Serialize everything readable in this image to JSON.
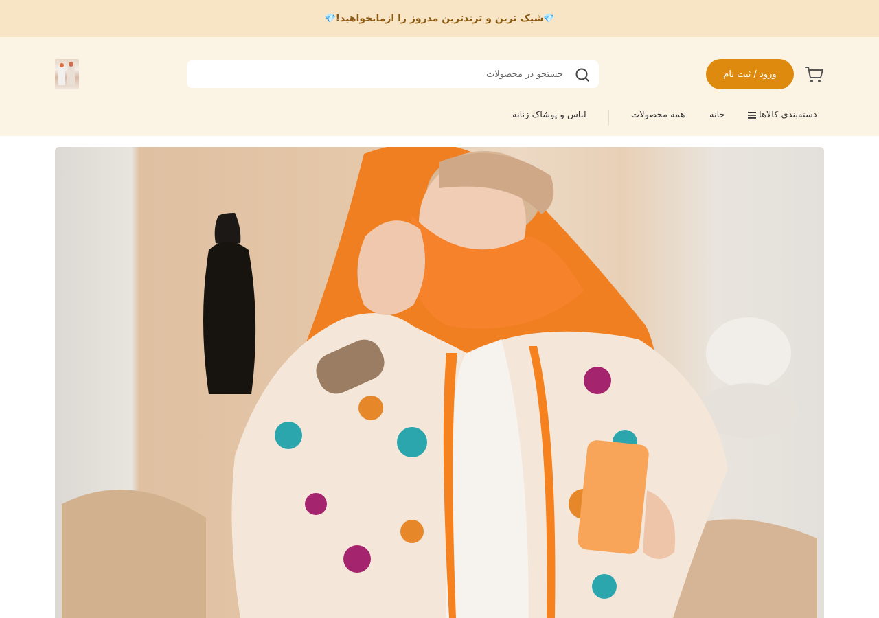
{
  "announcement": {
    "gem": "💎",
    "text": "شیک ترین و ترندترین مدروز را ازمابخواهید!"
  },
  "header": {
    "login_label": "ورود / ثبت نام",
    "search_placeholder": "جستجو در محصولات",
    "cart_icon": "cart-icon",
    "search_icon": "search-icon",
    "accent_color": "#de8a0e",
    "header_bg": "#fbf3e4",
    "announcement_bg": "#f7e5c5"
  },
  "nav": {
    "categories_label": "دسته‌بندی کالاها",
    "home_label": "خانه",
    "all_products_label": "همه محصولات",
    "women_clothing_label": "لباس و پوشاک زنانه"
  }
}
